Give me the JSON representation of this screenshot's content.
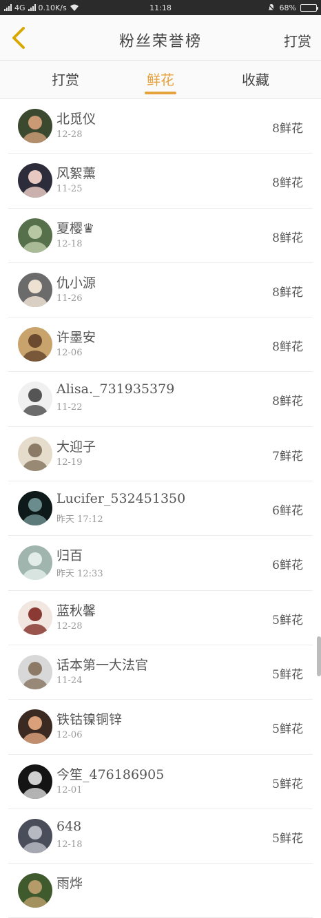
{
  "status_bar": {
    "network_type": "4G",
    "speed": "0.10K/s",
    "time": "11:18",
    "battery": "68%",
    "battery_level": 0.68
  },
  "nav": {
    "title": "粉丝荣誉榜",
    "action_label": "打赏"
  },
  "tabs": [
    {
      "label": "打赏",
      "active": false
    },
    {
      "label": "鲜花",
      "active": true
    },
    {
      "label": "收藏",
      "active": false
    }
  ],
  "accent_color": "#e6a23c",
  "rows": [
    {
      "name": "北觅仪",
      "date": "12-28",
      "score": "8鲜花",
      "avatar_colors": [
        "#3b4a2f",
        "#c99a74"
      ]
    },
    {
      "name": "风絮薰",
      "date": "11-25",
      "score": "8鲜花",
      "avatar_colors": [
        "#2c2c3a",
        "#e7c9c2"
      ]
    },
    {
      "name": "夏樱♛",
      "date": "12-18",
      "score": "8鲜花",
      "avatar_colors": [
        "#55704a",
        "#b8c7a3"
      ]
    },
    {
      "name": "仇小源",
      "date": "11-26",
      "score": "8鲜花",
      "avatar_colors": [
        "#6b6b6b",
        "#ede1d2"
      ]
    },
    {
      "name": "许墨安",
      "date": "12-06",
      "score": "8鲜花",
      "avatar_colors": [
        "#c8a36c",
        "#6a4b2f"
      ]
    },
    {
      "name": "Alisa._731935379",
      "date": "11-22",
      "score": "8鲜花",
      "avatar_colors": [
        "#f0f0f0",
        "#555555"
      ]
    },
    {
      "name": "大迎子",
      "date": "12-19",
      "score": "7鲜花",
      "avatar_colors": [
        "#e6dccb",
        "#8a7a66"
      ]
    },
    {
      "name": "Lucifer_532451350",
      "date": "昨天 17:12",
      "score": "6鲜花",
      "avatar_colors": [
        "#0e1a1a",
        "#6a8c8c"
      ]
    },
    {
      "name": "归百",
      "date": "昨天 12:33",
      "score": "6鲜花",
      "avatar_colors": [
        "#9fb5ae",
        "#e2ece8"
      ]
    },
    {
      "name": "蓝秋馨",
      "date": "12-28",
      "score": "5鲜花",
      "avatar_colors": [
        "#f2e6e0",
        "#8a3a32"
      ]
    },
    {
      "name": "话本第一大法官",
      "date": "11-24",
      "score": "5鲜花",
      "avatar_colors": [
        "#d8d8d8",
        "#8c7a66"
      ]
    },
    {
      "name": "铁钴镍铜锌",
      "date": "12-06",
      "score": "5鲜花",
      "avatar_colors": [
        "#3a2a22",
        "#d9a07a"
      ]
    },
    {
      "name": "今笙_476186905",
      "date": "12-01",
      "score": "5鲜花",
      "avatar_colors": [
        "#141414",
        "#cfcfcf"
      ]
    },
    {
      "name": "648",
      "date": "12-18",
      "score": "5鲜花",
      "avatar_colors": [
        "#4a4e5a",
        "#b6b9c2"
      ]
    },
    {
      "name": "雨烨",
      "date": "",
      "score": "",
      "avatar_colors": [
        "#3f5a2c",
        "#b59b6a"
      ]
    }
  ]
}
